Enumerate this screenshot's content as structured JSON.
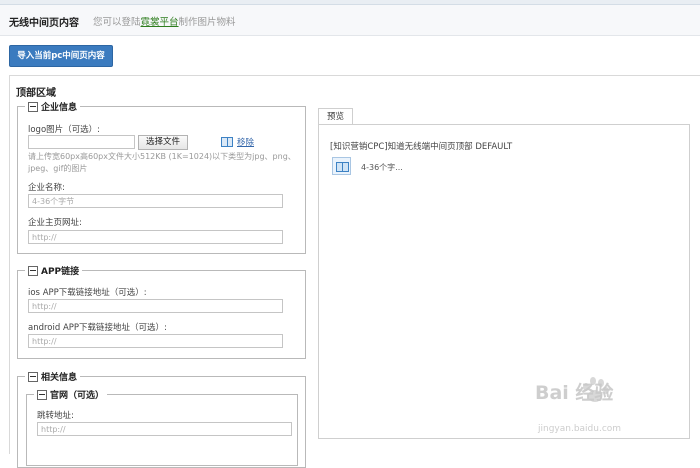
{
  "header": {
    "title": "无线中间页内容",
    "hint_prefix": "您可以登陆",
    "hint_link": "霓裳平台",
    "hint_suffix": "制作图片物料"
  },
  "import_button": "导入当前pc中间页内容",
  "section_title": "顶部区域",
  "enterprise": {
    "legend": "企业信息",
    "logo_label": "logo图片（可选）:",
    "file_button": "选择文件",
    "remove_link": "移除",
    "upload_note_line1": "请上传宽60px高60px文件大小512KB (1K=1024)以下类型为jpg、png、",
    "upload_note_line2": "jpeg、gif的图片",
    "name_label": "企业名称:",
    "name_placeholder": "4-36个字节",
    "homepage_label": "企业主页网址:",
    "homepage_placeholder": "http://"
  },
  "app": {
    "legend": "APP链接",
    "ios_label": "ios APP下载链接地址（可选）:",
    "ios_placeholder": "http://",
    "android_label": "android APP下载链接地址（可选）:",
    "android_placeholder": "http://"
  },
  "related": {
    "legend": "相关信息",
    "official": {
      "legend": "官网（可选）",
      "jump_label": "跳转地址:",
      "jump_placeholder": "http://"
    }
  },
  "preview": {
    "tab": "预览",
    "text": "[知识营销CPC]知道无线端中间页顶部 DEFAULT",
    "icon": "book-icon",
    "subtext": "4-36个字..."
  },
  "watermark": {
    "brand": "Bai 经验",
    "url": "jingyan.baidu.com"
  }
}
